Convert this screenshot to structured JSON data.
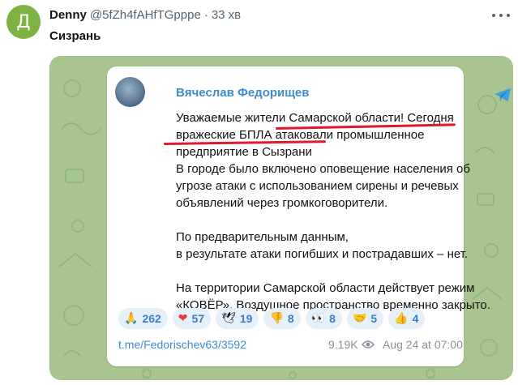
{
  "tweet": {
    "avatar_letter": "Д",
    "avatar_color": "#7cb342",
    "author_name": "Denny",
    "author_handle": "@5fZh4fAHfTGpppe",
    "separator": "·",
    "time": "33 хв",
    "text": "Сизрань"
  },
  "telegram_post": {
    "channel_name": "Вячеслав Федорищев",
    "paragraphs": [
      "Уважаемые жители Самарской области! Сегодня",
      "вражеские БПЛА атаковали промышленное",
      "предприятие в Сызрани",
      "В городе было включено оповещение населения об",
      "угрозе атаки с использованием сирены и речевых",
      "объявлений через громкоговорители.",
      "По предварительным данным,",
      "в результате атаки погибших и пострадавших – нет.",
      "На территории Самарской области действует режим",
      "«КОВЁР». Воздушное пространство временно закрыто."
    ],
    "reactions": [
      {
        "emoji": "🙏",
        "count": "262"
      },
      {
        "emoji": "❤",
        "count": "57"
      },
      {
        "emoji": "🕊",
        "count": "19"
      },
      {
        "emoji": "👎",
        "count": "8"
      },
      {
        "emoji": "👀",
        "count": "8"
      },
      {
        "emoji": "🤝",
        "count": "5"
      },
      {
        "emoji": "👍",
        "count": "4"
      }
    ],
    "link": "t.me/Fedorischev63/3592",
    "views": "9.19K",
    "date": "Aug 24 at 07:00"
  },
  "colors": {
    "link_blue": "#3f8bd0",
    "underline_red": "#e0192e",
    "media_background": "#a8c590"
  }
}
